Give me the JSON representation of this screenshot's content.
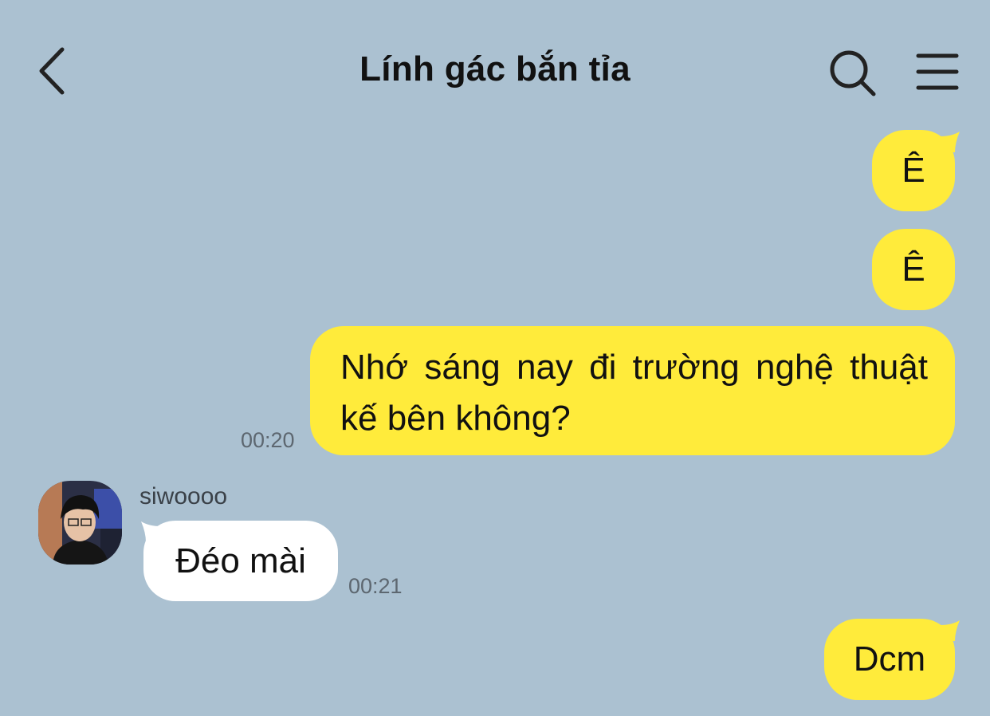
{
  "header": {
    "title": "Lính gác bắn tỉa",
    "back_icon": "chevron-left-icon",
    "search_icon": "search-icon",
    "menu_icon": "hamburger-menu-icon"
  },
  "colors": {
    "background": "#abc1d1",
    "my_bubble": "#ffeb3b",
    "their_bubble": "#ffffff"
  },
  "messages": [
    {
      "from": "me",
      "text": "Ê"
    },
    {
      "from": "me",
      "text": "Ê"
    },
    {
      "from": "me",
      "text": "Nhớ sáng nay đi trường nghệ thuật kế bên không?",
      "time": "00:20"
    },
    {
      "from": "siwoooo",
      "sender_name": "siwoooo",
      "text": "Đéo mài",
      "time": "00:21"
    },
    {
      "from": "me",
      "text": "Dcm"
    }
  ]
}
